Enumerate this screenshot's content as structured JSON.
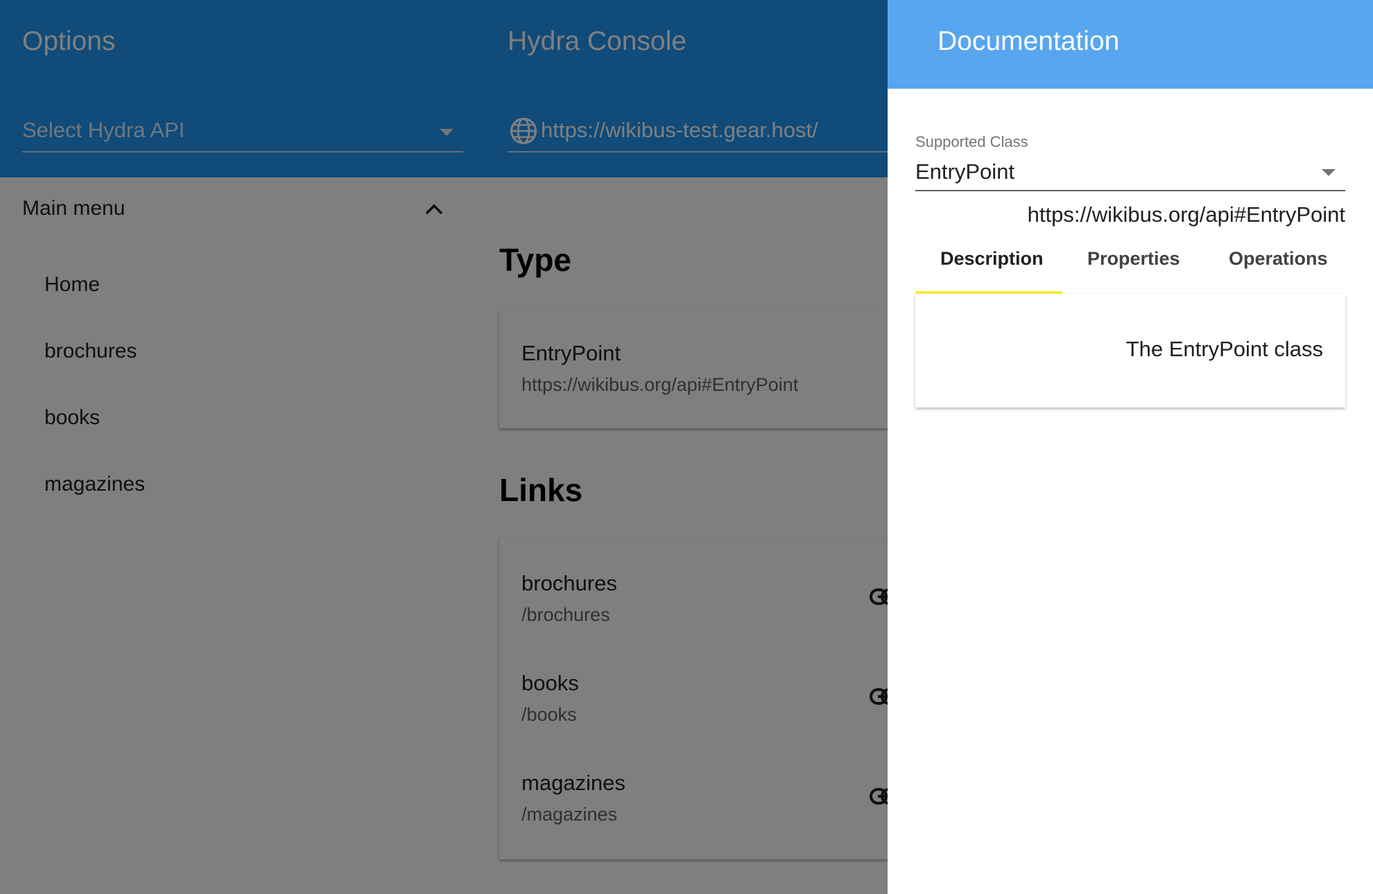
{
  "app": {
    "options_title": "Options",
    "console_title": "Hydra Console",
    "api_select": {
      "placeholder": "Select Hydra API",
      "icon": "chevron-down-icon"
    },
    "url_field": {
      "icon": "globe-icon",
      "value": "https://wikibus-test.gear.host/"
    }
  },
  "sidebar": {
    "header": "Main menu",
    "header_icon": "chevron-up-icon",
    "items": [
      {
        "label": "Home"
      },
      {
        "label": "brochures"
      },
      {
        "label": "books"
      },
      {
        "label": "magazines"
      }
    ]
  },
  "main": {
    "type_heading": "Type",
    "type_card": {
      "name": "EntryPoint",
      "iri": "https://wikibus.org/api#EntryPoint"
    },
    "links_heading": "Links",
    "links": [
      {
        "name": "brochures",
        "path": "/brochures",
        "icon": "link-icon"
      },
      {
        "name": "books",
        "path": "/books",
        "icon": "link-icon"
      },
      {
        "name": "magazines",
        "path": "/magazines",
        "icon": "link-icon"
      }
    ]
  },
  "drawer": {
    "title": "Documentation",
    "supported_class_label": "Supported Class",
    "supported_class_value": "EntryPoint",
    "class_iri": "https://wikibus.org/api#EntryPoint",
    "tabs": [
      {
        "label": "Description",
        "active": true
      },
      {
        "label": "Properties",
        "active": false
      },
      {
        "label": "Operations",
        "active": false
      }
    ],
    "description": "The EntryPoint class"
  },
  "colors": {
    "header": "#2196f3",
    "drawer_header": "#58a6f0",
    "tab_indicator": "#ffeb3b",
    "overlay": "rgba(0,0,0,0.5)"
  }
}
